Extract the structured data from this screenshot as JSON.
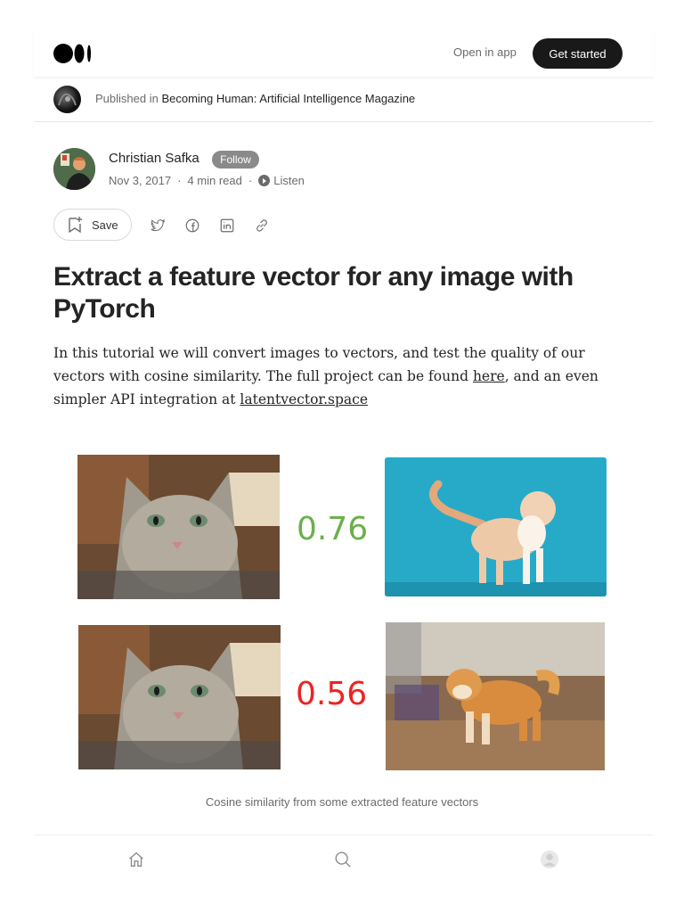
{
  "header": {
    "logo": "medium-logo",
    "open_in_app": "Open in app",
    "get_started": "Get started"
  },
  "publication": {
    "prefix": "Published in",
    "name": "Becoming Human: Artificial Intelligence Magazine"
  },
  "author": {
    "name": "Christian Safka",
    "follow_label": "Follow",
    "date": "Nov 3, 2017",
    "read_time": "4 min read",
    "listen_label": "Listen",
    "separator": "·"
  },
  "actions": {
    "save_label": "Save",
    "icons": [
      "bookmark-icon",
      "twitter-icon",
      "facebook-icon",
      "linkedin-icon",
      "link-icon"
    ]
  },
  "article": {
    "title": "Extract a feature vector for any image with PyTorch",
    "intro_1": "In this tutorial we will convert images to vectors, and test the quality of our vectors with cosine similarity. The full project can be found ",
    "intro_link_1": "here",
    "intro_2": ", and an even simpler API integration at ",
    "intro_link_2": "latentvector.space"
  },
  "figure": {
    "score_1": "0.76",
    "score_2": "0.56",
    "score_1_color": "#6ab04a",
    "score_2_color": "#ee2222",
    "caption": "Cosine similarity from some extracted feature vectors"
  },
  "bottom_nav": {
    "icons": [
      "home-icon",
      "search-icon",
      "profile-icon"
    ]
  }
}
